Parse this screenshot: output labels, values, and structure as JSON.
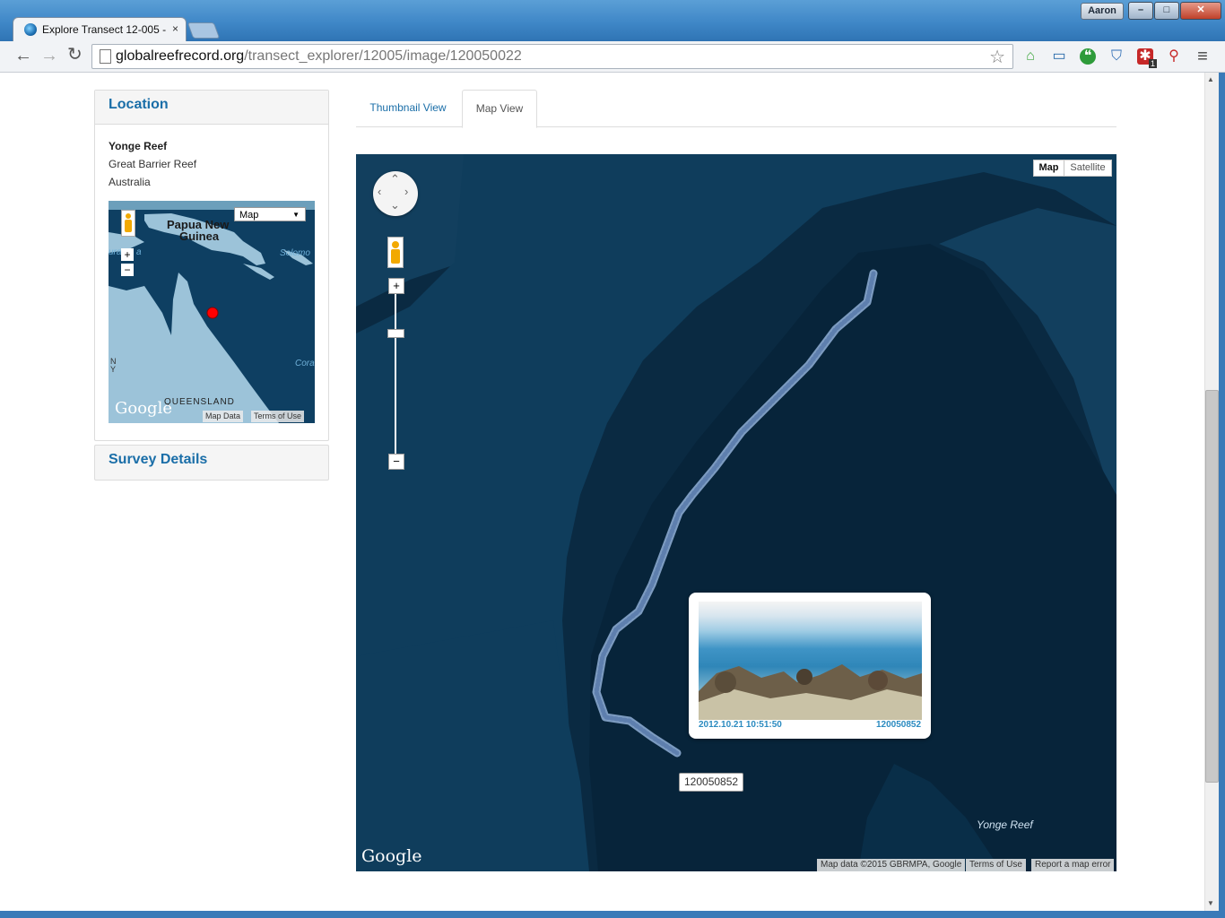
{
  "window": {
    "user": "Aaron",
    "minimize": "–",
    "maximize": "□",
    "close": "✕"
  },
  "tab": {
    "title": "Explore Transect 12-005 -",
    "close": "×"
  },
  "address": {
    "domain": "globalreefrecord.org",
    "path": "/transect_explorer/12005/image/120050022"
  },
  "toolbar": {
    "back": "←",
    "forward": "→",
    "reload": "↻",
    "star": "☆",
    "menu": "≡",
    "ext_badge": "1"
  },
  "location_panel": {
    "title": "Location",
    "name": "Yonge Reef",
    "region": "Great Barrier Reef",
    "country": "Australia",
    "mini_map": {
      "type_select": "Map",
      "label_png": "Papua New",
      "label_png2": "Guinea",
      "label_solomon": "Solomo",
      "label_coral": "Cora",
      "label_queensland": "QUEENSLAND",
      "label_ura": "ura",
      "label_a": "a",
      "label_ny": "N",
      "label_ny2": "Y",
      "google": "Google",
      "map_data": "Map Data",
      "terms": "Terms of Use",
      "zoom_in": "+",
      "zoom_out": "−"
    }
  },
  "survey_panel": {
    "title": "Survey Details"
  },
  "view_tabs": [
    {
      "label": "Thumbnail View"
    },
    {
      "label": "Map View"
    }
  ],
  "map": {
    "type_map": "Map",
    "type_satellite": "Satellite",
    "zoom_in": "+",
    "zoom_out": "−",
    "reef_label": "Yonge Reef",
    "google": "Google",
    "attribution": "Map data ©2015 GBRMPA, Google",
    "terms": "Terms of Use",
    "report": "Report a map error",
    "marker_label": "120050852",
    "info": {
      "timestamp": "2012.10.21 10:51:50",
      "image_id": "120050852"
    }
  },
  "colors": {
    "link": "#1a6ea8",
    "water_deep": "#0b2c44",
    "water": "#0f3d5c",
    "track": "#7f9fc8",
    "marker": "#ff0000"
  }
}
